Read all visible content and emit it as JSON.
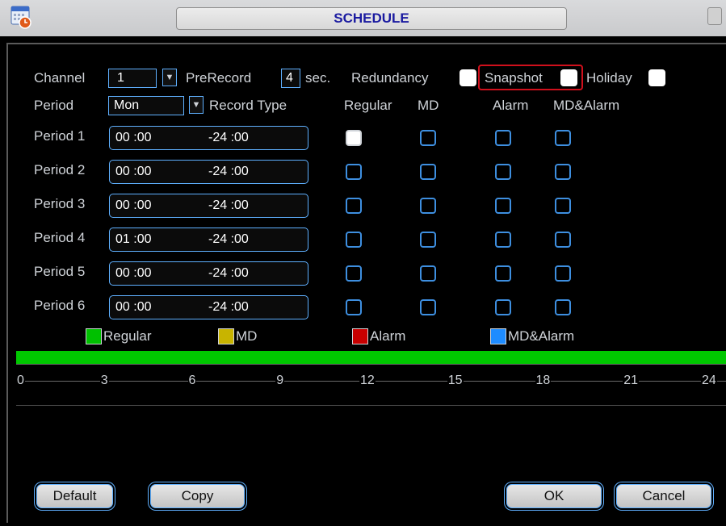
{
  "window": {
    "title": "SCHEDULE",
    "app_icon": "dvr-calendar-icon"
  },
  "settings": {
    "channel_label": "Channel",
    "channel_value": "1",
    "prerecord_label": "PreRecord",
    "prerecord_value": "4",
    "prerecord_unit": "sec.",
    "redundancy_label": "Redundancy",
    "redundancy_checked": true,
    "snapshot_label": "Snapshot",
    "snapshot_checked": true,
    "holiday_label": "Holiday",
    "holiday_checked": true
  },
  "period_header": {
    "period_label": "Period",
    "day_value": "Mon",
    "record_type_label": "Record Type",
    "columns": [
      "Regular",
      "MD",
      "Alarm",
      "MD&Alarm"
    ]
  },
  "periods": [
    {
      "label": "Period 1",
      "start": "00 :00",
      "end": "-24 :00",
      "regular": true,
      "md": false,
      "alarm": false,
      "md_alarm": false
    },
    {
      "label": "Period 2",
      "start": "00 :00",
      "end": "-24 :00",
      "regular": false,
      "md": false,
      "alarm": false,
      "md_alarm": false
    },
    {
      "label": "Period 3",
      "start": "00 :00",
      "end": "-24 :00",
      "regular": false,
      "md": false,
      "alarm": false,
      "md_alarm": false
    },
    {
      "label": "Period 4",
      "start": "01 :00",
      "end": "-24 :00",
      "regular": false,
      "md": false,
      "alarm": false,
      "md_alarm": false
    },
    {
      "label": "Period 5",
      "start": "00 :00",
      "end": "-24 :00",
      "regular": false,
      "md": false,
      "alarm": false,
      "md_alarm": false
    },
    {
      "label": "Period 6",
      "start": "00 :00",
      "end": "-24 :00",
      "regular": false,
      "md": false,
      "alarm": false,
      "md_alarm": false
    }
  ],
  "legend": [
    {
      "label": "Regular",
      "color": "#00c000"
    },
    {
      "label": "MD",
      "color": "#c8b400"
    },
    {
      "label": "Alarm",
      "color": "#c80000"
    },
    {
      "label": "MD&Alarm",
      "color": "#1e8cff"
    }
  ],
  "timeline": {
    "bar_color": "#00c800",
    "ticks": [
      "0",
      "3",
      "6",
      "9",
      "12",
      "15",
      "18",
      "21",
      "24"
    ]
  },
  "buttons": {
    "default": "Default",
    "copy": "Copy",
    "ok": "OK",
    "cancel": "Cancel"
  },
  "highlight_color": "#d0101c"
}
